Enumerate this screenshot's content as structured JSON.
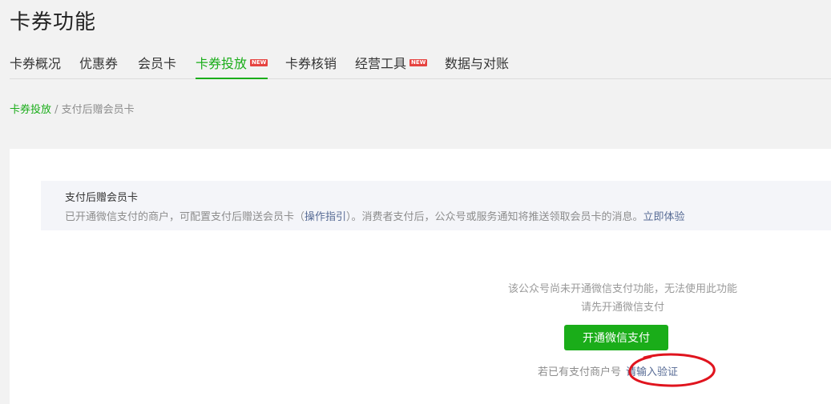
{
  "page": {
    "title": "卡券功能"
  },
  "tabs": [
    {
      "label": "卡券概况",
      "new": false,
      "active": false
    },
    {
      "label": "优惠券",
      "new": false,
      "active": false
    },
    {
      "label": "会员卡",
      "new": false,
      "active": false
    },
    {
      "label": "卡券投放",
      "new": true,
      "active": true
    },
    {
      "label": "卡券核销",
      "new": false,
      "active": false
    },
    {
      "label": "经营工具",
      "new": true,
      "active": false
    },
    {
      "label": "数据与对账",
      "new": false,
      "active": false
    }
  ],
  "new_badge": "NEW",
  "breadcrumb": {
    "parent": "卡券投放",
    "separator": " / ",
    "current": "支付后赠会员卡"
  },
  "notice": {
    "title": "支付后赠会员卡",
    "desc_before": "已开通微信支付的商户，可配置支付后赠送会员卡（",
    "guide_link": "操作指引",
    "desc_after": "）。消费者支付后，公众号或服务通知将推送领取会员卡的消息。",
    "try_link": "立即体验"
  },
  "empty_state": {
    "line1": "该公众号尚未开通微信支付功能，无法使用此功能",
    "line2": "请先开通微信支付",
    "button_label": "开通微信支付",
    "hint_text": "若已有支付商户号",
    "verify_link": "请输入验证"
  },
  "colors": {
    "accent": "#1aad19",
    "link": "#576b95",
    "annotation": "#e0141e"
  },
  "annotation": {
    "shape": "ellipse",
    "target": "verify_link"
  }
}
